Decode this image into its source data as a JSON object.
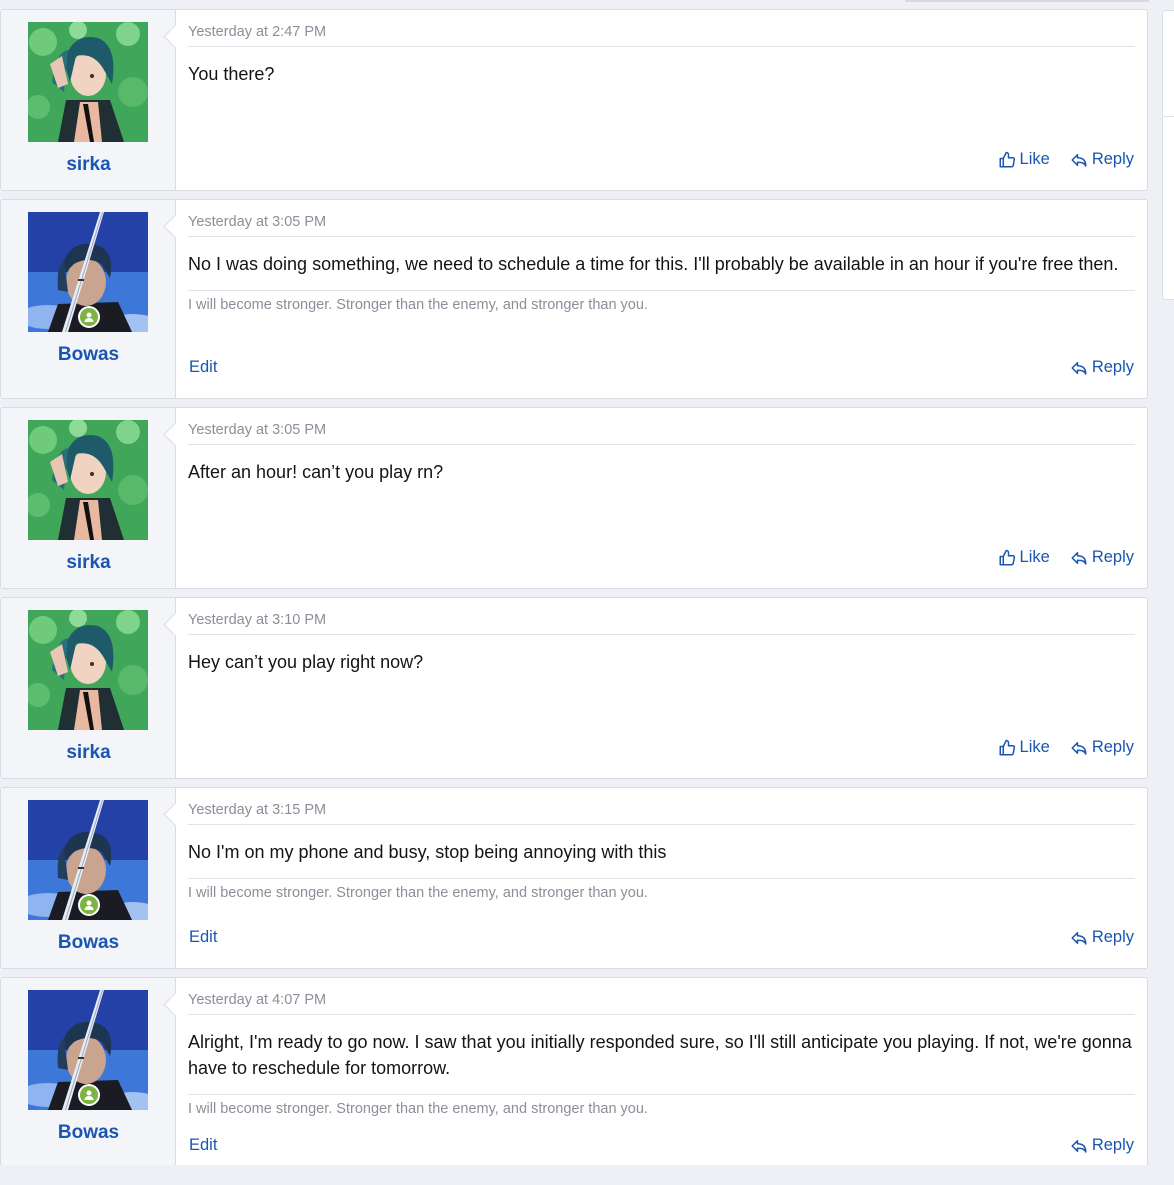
{
  "theme": {
    "link": "#1a56b0",
    "muted": "#8a8f99",
    "online": "#7cb342"
  },
  "posts": [
    {
      "user": "sirka",
      "avatar": "sirka-avatar",
      "online": false,
      "time": "Yesterday at 2:47 PM",
      "body": "You there?",
      "signature": "",
      "edit_label": "",
      "like_label": "Like",
      "reply_label": "Reply"
    },
    {
      "user": "Bowas",
      "avatar": "bowas-avatar",
      "online": true,
      "time": "Yesterday at 3:05 PM",
      "body": "No I was doing something, we need to schedule a time for this. I'll probably be available in an hour if you're free then.",
      "signature": "I will become stronger. Stronger than the enemy, and stronger than you.",
      "edit_label": "Edit",
      "like_label": "",
      "reply_label": "Reply"
    },
    {
      "user": "sirka",
      "avatar": "sirka-avatar",
      "online": false,
      "time": "Yesterday at 3:05 PM",
      "body": "After an hour! can’t you play rn?",
      "signature": "",
      "edit_label": "",
      "like_label": "Like",
      "reply_label": "Reply"
    },
    {
      "user": "sirka",
      "avatar": "sirka-avatar",
      "online": false,
      "time": "Yesterday at 3:10 PM",
      "body": "Hey can’t you play right now?",
      "signature": "",
      "edit_label": "",
      "like_label": "Like",
      "reply_label": "Reply"
    },
    {
      "user": "Bowas",
      "avatar": "bowas-avatar",
      "online": true,
      "time": "Yesterday at 3:15 PM",
      "body": "No I'm on my phone and busy, stop being annoying with this",
      "signature": "I will become stronger. Stronger than the enemy, and stronger than you.",
      "edit_label": "Edit",
      "like_label": "",
      "reply_label": "Reply"
    },
    {
      "user": "Bowas",
      "avatar": "bowas-avatar",
      "online": true,
      "time": "Yesterday at 4:07 PM",
      "body": "Alright, I'm ready to go now. I saw that you initially responded sure, so I'll still anticipate you playing. If not, we're gonna have to reschedule for tomorrow.",
      "signature": "I will become stronger. Stronger than the enemy, and stronger than you.",
      "edit_label": "Edit",
      "like_label": "",
      "reply_label": "Reply"
    }
  ]
}
